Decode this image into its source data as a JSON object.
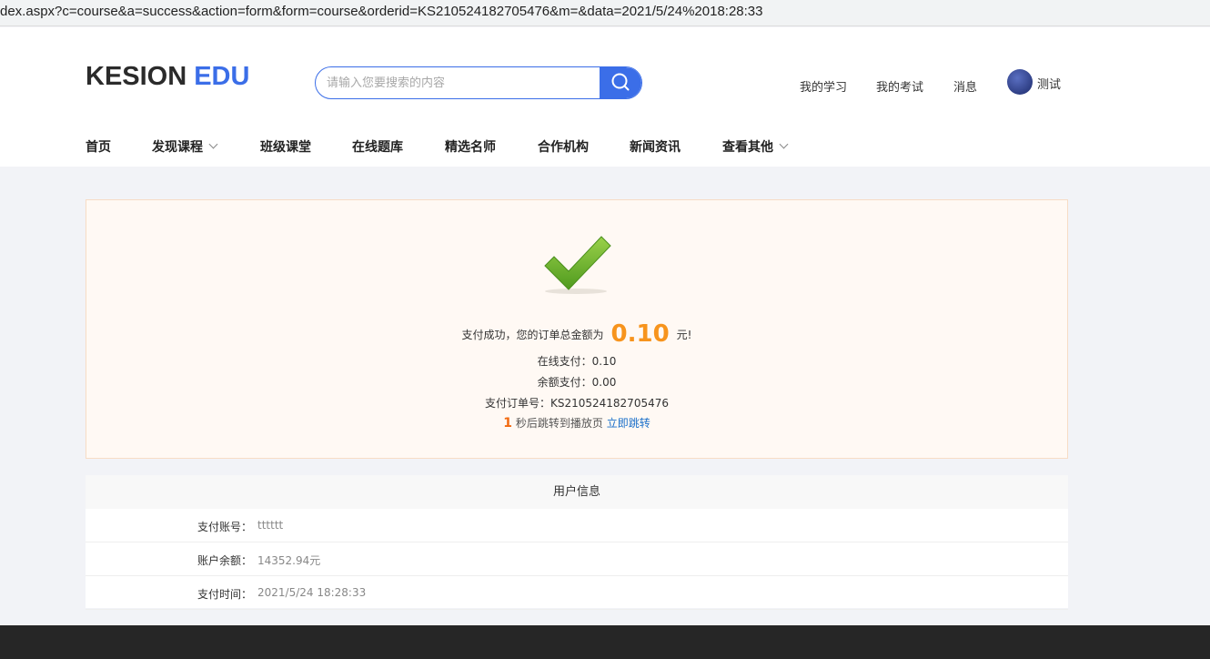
{
  "browser": {
    "url": "dex.aspx?c=course&a=success&action=form&form=course&orderid=KS210524182705476&m=&data=2021/5/24%2018:28:33"
  },
  "header": {
    "logo_part1": "KESION",
    "logo_part2": "EDU",
    "search_placeholder": "请输入您要搜索的内容",
    "links": [
      "我的学习",
      "我的考试",
      "消息"
    ],
    "user_name": "测试"
  },
  "nav": {
    "items": [
      {
        "label": "首页"
      },
      {
        "label": "发现课程"
      },
      {
        "label": "班级课堂"
      },
      {
        "label": "在线题库"
      },
      {
        "label": "精选名师"
      },
      {
        "label": "合作机构"
      },
      {
        "label": "新闻资讯"
      },
      {
        "label": "查看其他"
      }
    ]
  },
  "success": {
    "message_prefix": "支付成功，您的订单总金额为",
    "amount": "0.10",
    "message_suffix": "元!",
    "online_payment": "在线支付：0.10",
    "balance_payment": "余额支付：0.00",
    "order_number": "支付订单号：KS210524182705476",
    "countdown": "1",
    "countdown_text": "秒后跳转到播放页",
    "jump_link": "立即跳转"
  },
  "user_info": {
    "title": "用户信息",
    "rows": [
      {
        "label": "支付账号：",
        "value": "tttttt"
      },
      {
        "label": "账户余额：",
        "value": "14352.94元"
      },
      {
        "label": "支付时间：",
        "value": "2021/5/24 18:28:33"
      }
    ]
  },
  "colors": {
    "accent": "#3b6ee8",
    "amount": "#f7941d",
    "success_bg": "#fff9f4",
    "check_green": "#6cb32a",
    "link": "#1a6fc9"
  }
}
